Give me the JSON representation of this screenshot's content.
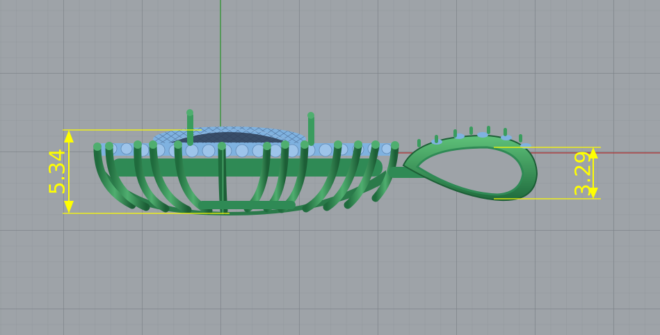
{
  "viewport": {
    "background": "#9ea3a8",
    "model_color": "#2e8b57",
    "gem_color": "#7fb2e0",
    "dimension_color": "#ffff00",
    "x_axis_color": "#b03030",
    "y_axis_color": "#2e9a2e"
  },
  "dimensions": {
    "height_left": "5.34",
    "height_right": "3.29"
  }
}
